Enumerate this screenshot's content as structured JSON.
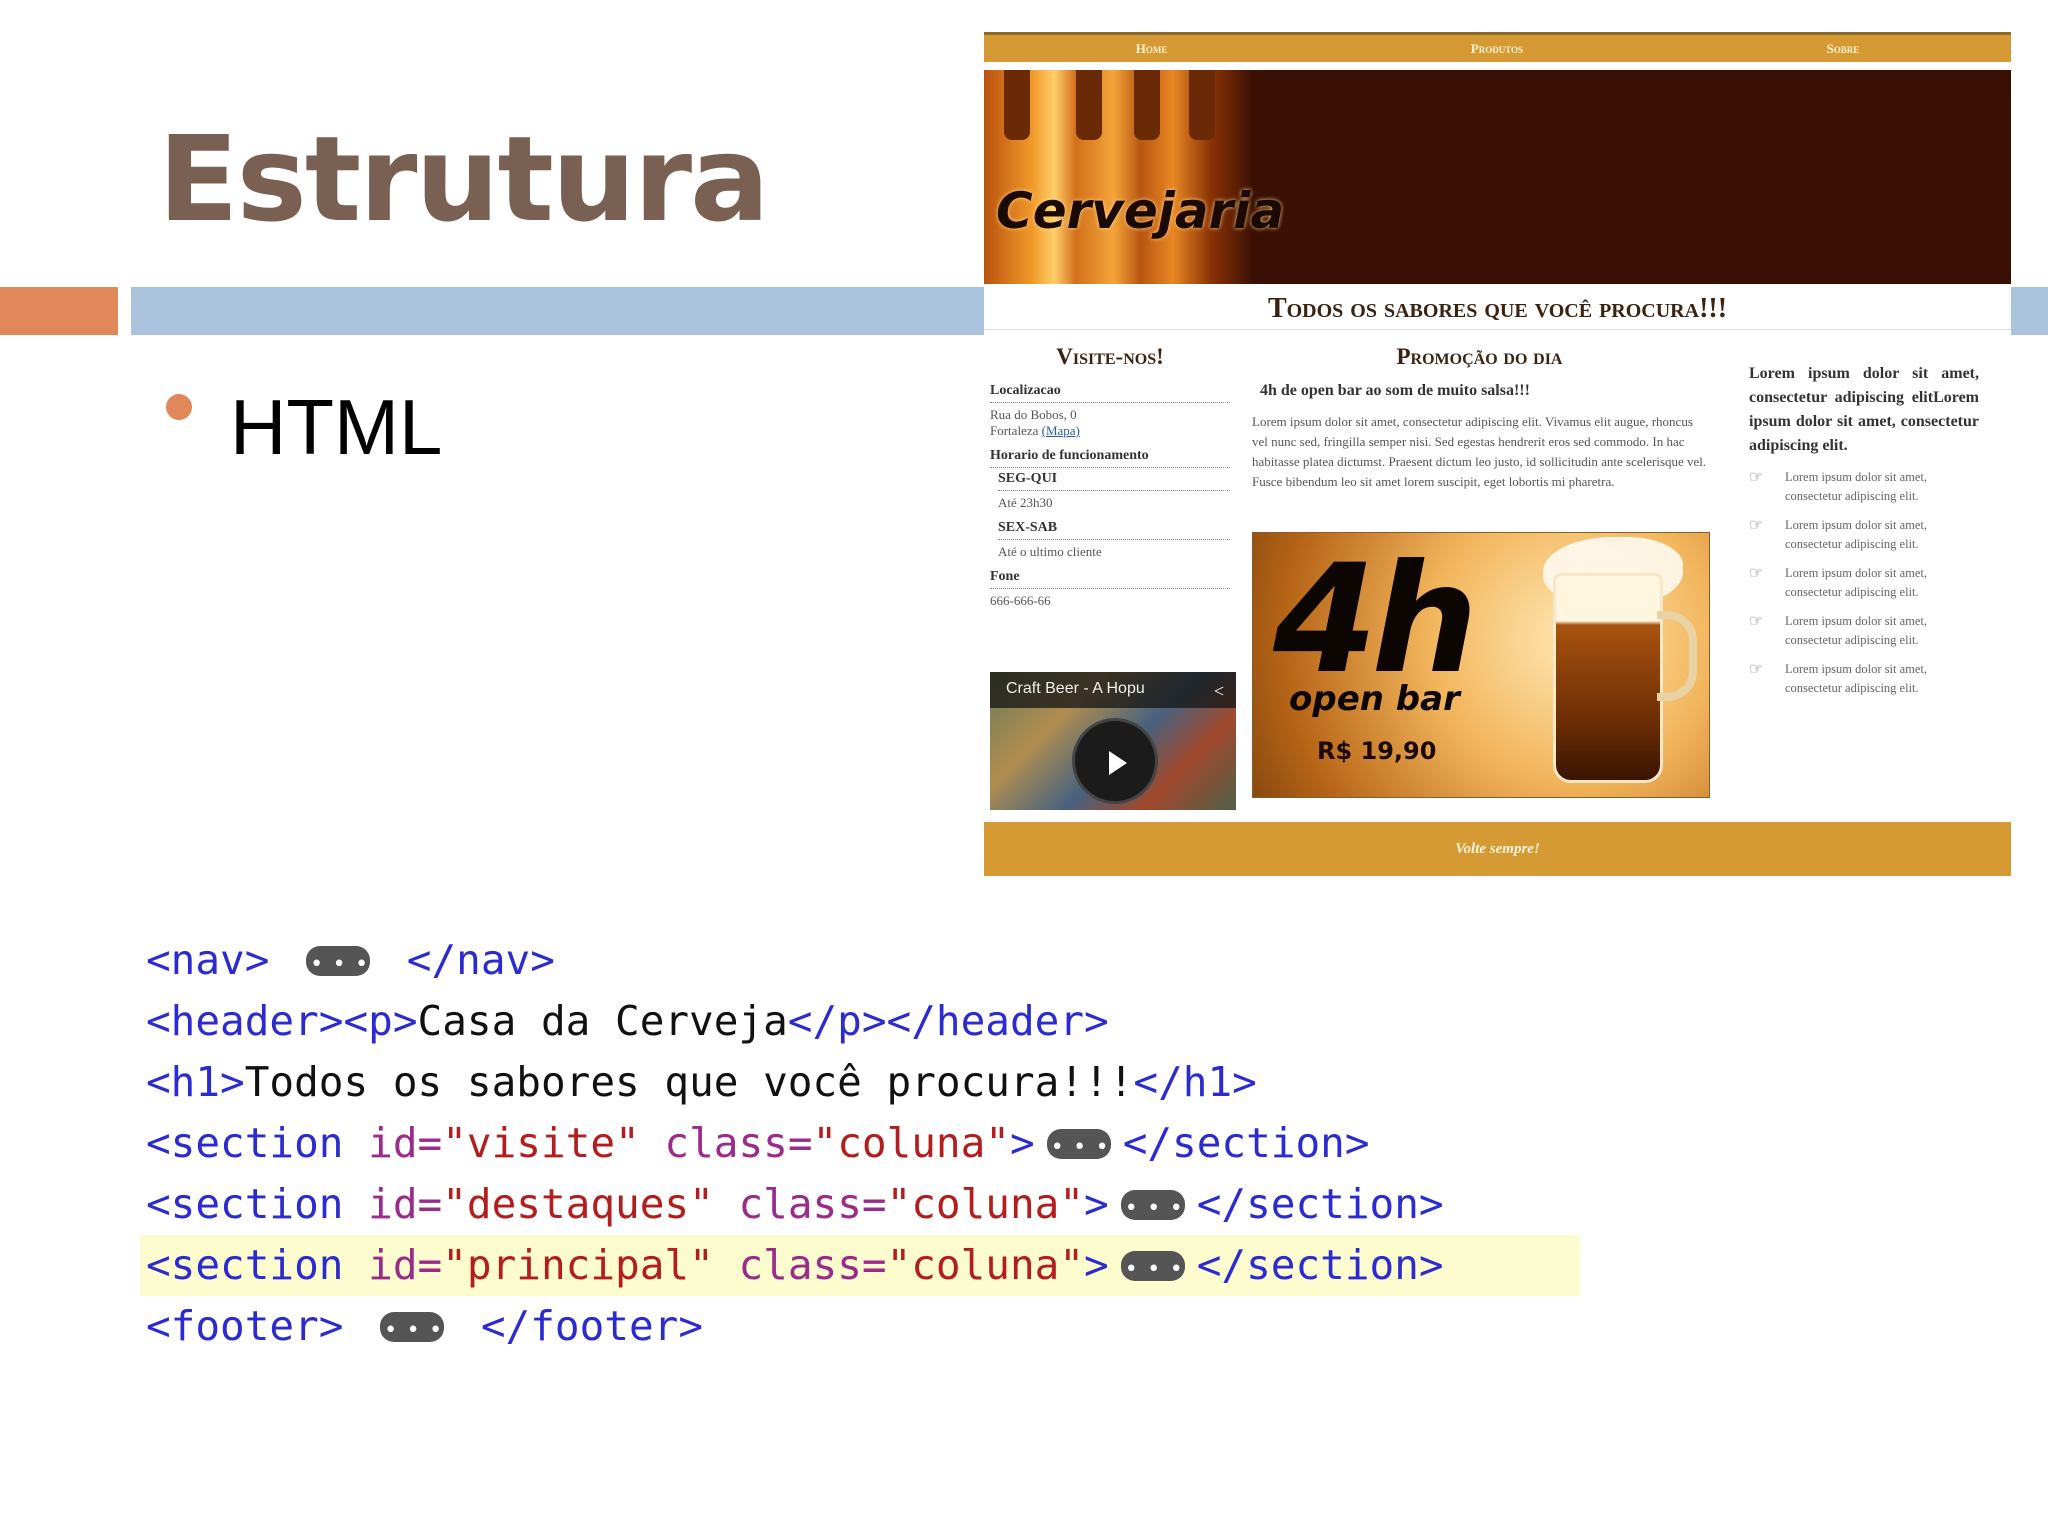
{
  "slide": {
    "title": "Estrutura",
    "bullet": "HTML"
  },
  "mockup": {
    "nav": [
      "Home",
      "Produtos",
      "Sobre"
    ],
    "logo": "Cervejaria",
    "headline": "Todos os sabores que você procura!!!",
    "visit": {
      "title": "Visite-nos!",
      "location_label": "Localizacao",
      "address": "Rua do Bobos, 0",
      "city": "Fortaleza",
      "map_link": "(Mapa)",
      "hours_label": "Horario de funcionamento",
      "days1": "SEG-QUI",
      "hours1": "Até 23h30",
      "days2": "SEX-SAB",
      "hours2": "Até o ultimo cliente",
      "phone_label": "Fone",
      "phone": "666-666-66",
      "video_title": "Craft Beer - A Hopu"
    },
    "promo": {
      "title": "Promoção do dia",
      "subtitle": "4h de open bar ao som de muito salsa!!!",
      "text": "Lorem ipsum dolor sit amet, consectetur adipiscing elit. Vivamus elit augue, rhoncus vel nunc sed, fringilla semper nisi. Sed egestas hendrerit eros sed commodo. In hac habitasse platea dictumst. Praesent dictum leo justo, id sollicitudin ante scelerisque vel. Fusce bibendum leo sit amet lorem suscipit, eget lobortis mi pharetra.",
      "banner_big": "4h",
      "banner_sub": "open bar",
      "banner_price": "R$ 19,90"
    },
    "sidebar": {
      "intro": "Lorem ipsum dolor sit amet, consectetur adipiscing elitLorem ipsum dolor sit amet, consectetur adipiscing elit.",
      "items": [
        "Lorem ipsum dolor sit amet, consectetur adipiscing elit.",
        "Lorem ipsum dolor sit amet, consectetur adipiscing elit.",
        "Lorem ipsum dolor sit amet, consectetur adipiscing elit.",
        "Lorem ipsum dolor sit amet, consectetur adipiscing elit.",
        "Lorem ipsum dolor sit amet, consectetur adipiscing elit."
      ]
    },
    "footer": "Volte sempre!"
  },
  "code": {
    "l1_open": "<nav>",
    "l1_close": "</nav>",
    "l2_tag1": "<header><p>",
    "l2_text": "Casa da Cerveja",
    "l2_tag2": "</p></header>",
    "l3_tag1": "<h1>",
    "l3_text": "Todos os sabores que você procura!!!",
    "l3_tag2": "</h1>",
    "section_open": "<section ",
    "id_attr": "id=",
    "class_attr": "class=",
    "coluna": "\"coluna\"",
    "gt": ">",
    "section_close": "</section>",
    "l4_id": "\"visite\"",
    "l5_id": "\"destaques\"",
    "l6_id": "\"principal\"",
    "l7_open": "<footer>",
    "l7_close": "</footer>"
  },
  "colors": {
    "title": "#7a5f53",
    "accent_orange": "#e0885a",
    "accent_blue": "#a9c4dc",
    "code_tag": "#2b2bd1",
    "code_attr": "#9b2a8a",
    "code_string": "#b31d1d",
    "highlight": "#fdfccf"
  }
}
